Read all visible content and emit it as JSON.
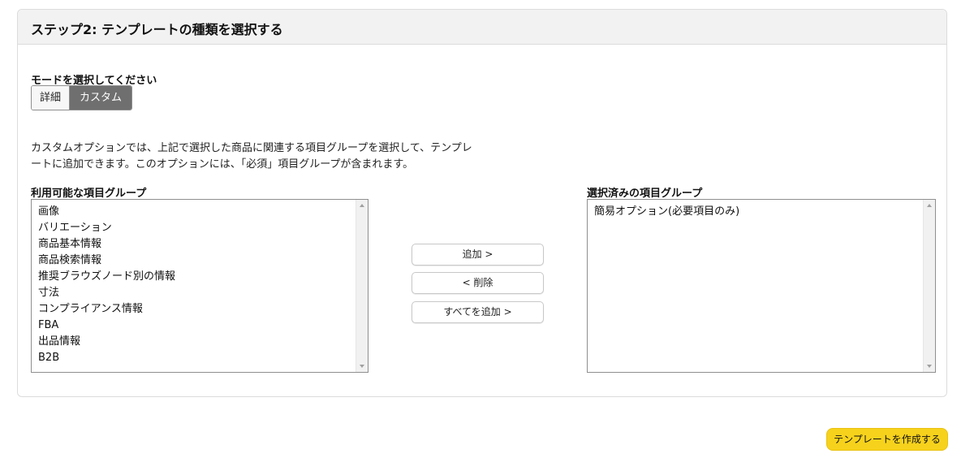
{
  "step_header": {
    "title": "ステップ2: テンプレートの種類を選択する"
  },
  "mode": {
    "label": "モードを選択してください",
    "options": [
      "詳細",
      "カスタム"
    ],
    "selected": "カスタム"
  },
  "description": {
    "line1": "カスタムオプションでは、上記で選択した商品に関連する項目グループを選択して、テンプレ",
    "line2": "ートに追加できます。このオプションには、「必須」項目グループが含まれます。"
  },
  "available": {
    "label": "利用可能な項目グループ",
    "items": [
      "画像",
      "バリエーション",
      "商品基本情報",
      "商品検索情報",
      "推奨ブラウズノード別の情報",
      "寸法",
      "コンプライアンス情報",
      "FBA",
      "出品情報",
      "B2B"
    ]
  },
  "selected_groups": {
    "label": "選択済みの項目グループ",
    "items": [
      "簡易オプション(必要項目のみ)"
    ]
  },
  "actions": {
    "add": "追加 >",
    "remove": "< 削除",
    "add_all": "すべてを追加 >"
  },
  "footer": {
    "create_button": "テンプレートを作成する"
  },
  "colors": {
    "accent_button": "#f7d21c",
    "segment_active": "#6f6f6f",
    "header_bg": "#f2f2f2"
  }
}
